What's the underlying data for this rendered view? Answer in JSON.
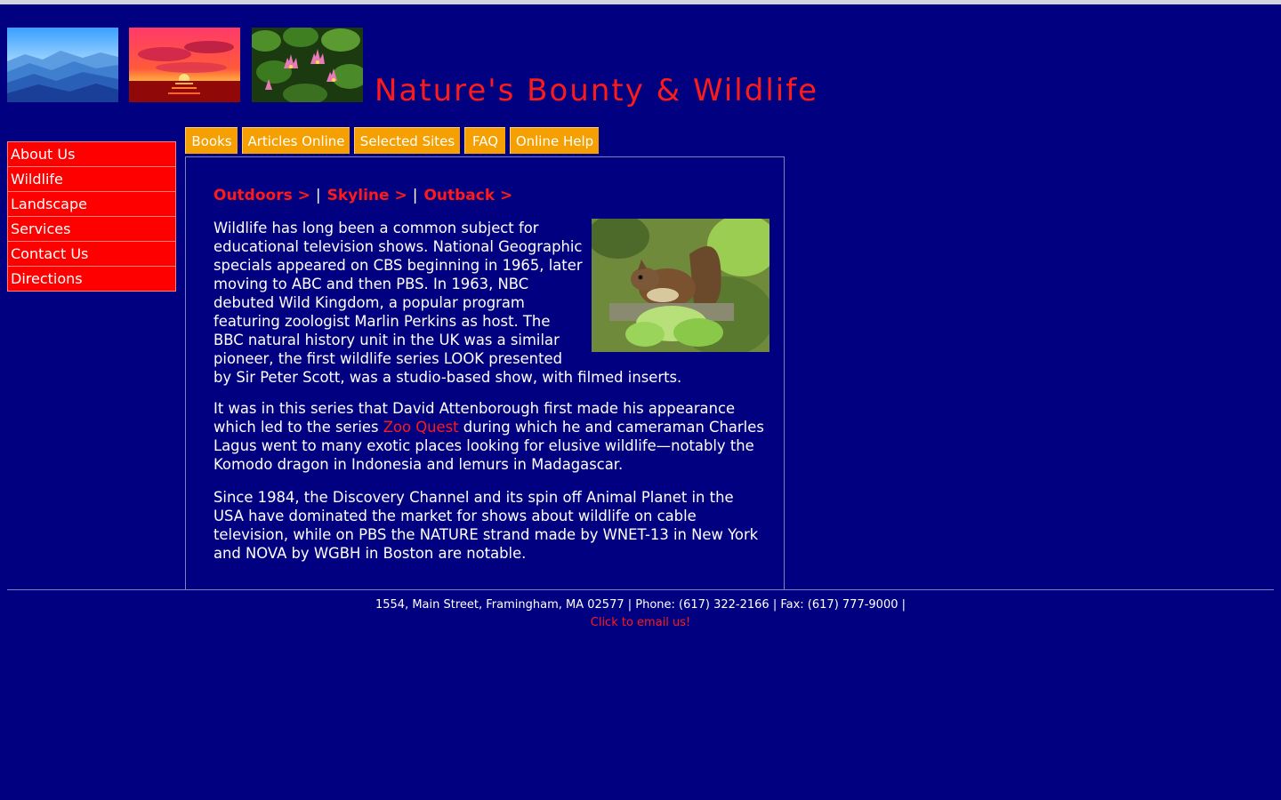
{
  "header": {
    "title": "Nature's Bounty & Wildlife",
    "images": [
      "blue-mountains-image",
      "red-sunset-image",
      "water-lilies-image"
    ]
  },
  "sidebar": {
    "items": [
      {
        "label": "About Us"
      },
      {
        "label": "Wildlife"
      },
      {
        "label": "Landscape"
      },
      {
        "label": "Services"
      },
      {
        "label": "Contact Us"
      },
      {
        "label": "Directions"
      }
    ]
  },
  "tabs": [
    {
      "label": "Books"
    },
    {
      "label": "Articles Online"
    },
    {
      "label": "Selected Sites"
    },
    {
      "label": "FAQ"
    },
    {
      "label": "Online Help"
    }
  ],
  "breadcrumbs": [
    {
      "label": "Outdoors >"
    },
    {
      "label": "Skyline >"
    },
    {
      "label": "Outback >"
    }
  ],
  "breadcrumb_separator": "|",
  "content": {
    "photo": "squirrel-photo",
    "p1_lines": [
      "Wildlife has long been a common subject for",
      "educational television shows. National Geographic",
      "specials appeared on CBS beginning in 1965, later",
      "moving to ABC and then PBS. In 1963, NBC",
      "debuted Wild Kingdom, a popular program",
      "featuring zoologist Marlin Perkins as host. The",
      "BBC natural history unit in the UK was a similar",
      "pioneer, the first wildlife series LOOK presented",
      "by Sir Peter Scott, was a studio-based show, with filmed inserts."
    ],
    "p2_line1": "It was in this series that David Attenborough first made his appearance",
    "p2_line2_before": "which led to the series ",
    "p2_link": "Zoo Quest",
    "p2_line2_after": " during which he and cameraman Charles",
    "p2_line3": "Lagus went to many exotic places looking for elusive wildlife—notably the",
    "p2_line4": "Komodo dragon in Indonesia and lemurs in Madagascar.",
    "p3_lines": [
      "Since 1984, the Discovery Channel and its spin off Animal Planet in the",
      "USA have dominated the market for shows about wildlife on cable",
      "television, while on PBS the NATURE strand made by WNET-13 in New York",
      "and NOVA by WGBH in Boston are notable."
    ]
  },
  "footer": {
    "address": "1554, Main Street, Framingham, MA 02577 | Phone: (617) 322-2166 | Fax: (617) 777-9000 |",
    "email_link": "Click to email us!"
  },
  "colors": {
    "background": "#000080",
    "accent_red": "#ff0000",
    "tab_orange": "#f5a000",
    "text": "#ffffff"
  }
}
